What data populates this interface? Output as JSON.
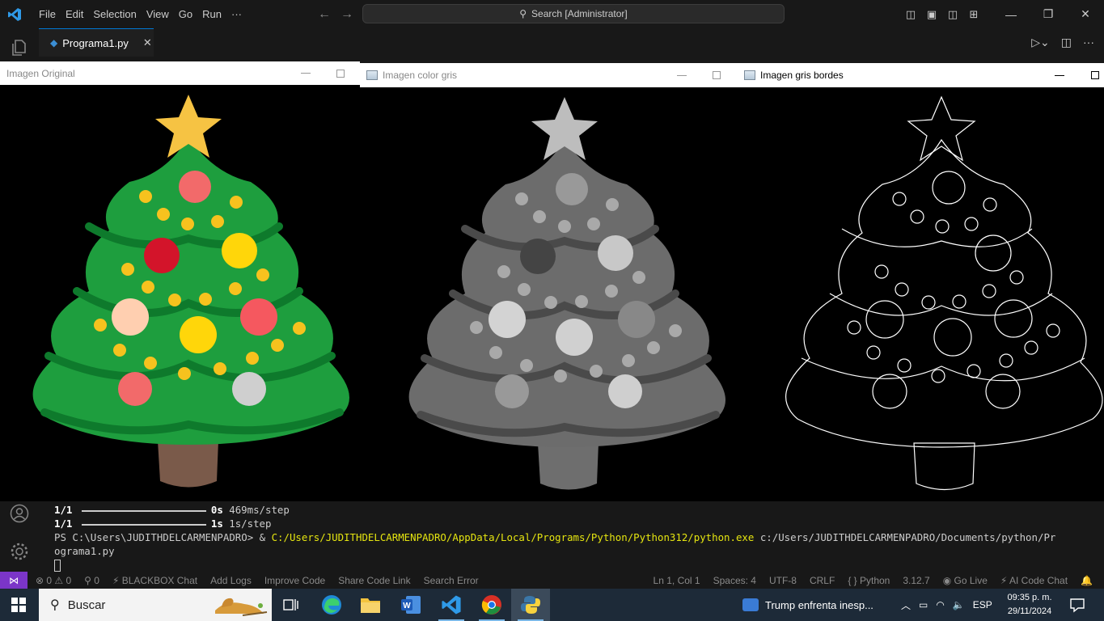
{
  "vscode": {
    "menu": [
      "File",
      "Edit",
      "Selection",
      "View",
      "Go",
      "Run",
      "···"
    ],
    "search_label": "Search [Administrator]",
    "tab_label": "Programa1.py",
    "tab_close": "✕"
  },
  "windows": [
    {
      "title": "Imagen Original"
    },
    {
      "title": "Imagen color gris"
    },
    {
      "title": "Imagen gris bordes"
    }
  ],
  "terminal": {
    "line1_count": "1/1",
    "line1_time": "0s",
    "line1_step": "469ms/step",
    "line2_count": "1/1",
    "line2_time": "1s",
    "line2_step": "1s/step",
    "prompt": "PS C:\\Users\\JUDITHDELCARMENPADRO> &",
    "exe": "C:/Users/JUDITHDELCARMENPADRO/AppData/Local/Programs/Python/Python312/python.exe",
    "script_a": "c:/Users/JUDITHDELCARMENPADRO/Documents/python/Pr",
    "script_b": "ograma1.py"
  },
  "statusbar": {
    "left": [
      "⊗ 0 ⚠ 0",
      "⚲ 0",
      "⚡ BLACKBOX Chat",
      "Add Logs",
      "Improve Code",
      "Share Code Link",
      "Search Error"
    ],
    "right": [
      "Ln 1, Col 1",
      "Spaces: 4",
      "UTF-8",
      "CRLF",
      "{ } Python",
      "3.12.7",
      "◉ Go Live",
      "⚡ AI Code Chat",
      "🔔"
    ]
  },
  "taskbar": {
    "search_label": "Buscar",
    "news": "Trump enfrenta inesp...",
    "language": "ESP",
    "time": "09:35 p. m.",
    "date": "29/11/2024"
  },
  "colors": {
    "accent": "#0078d4",
    "remote": "#7b35c8",
    "tree_green": "#1e9e3e",
    "tree_dark": "#0e7a2c",
    "star": "#f6c343",
    "trunk": "#7a5a4a"
  }
}
